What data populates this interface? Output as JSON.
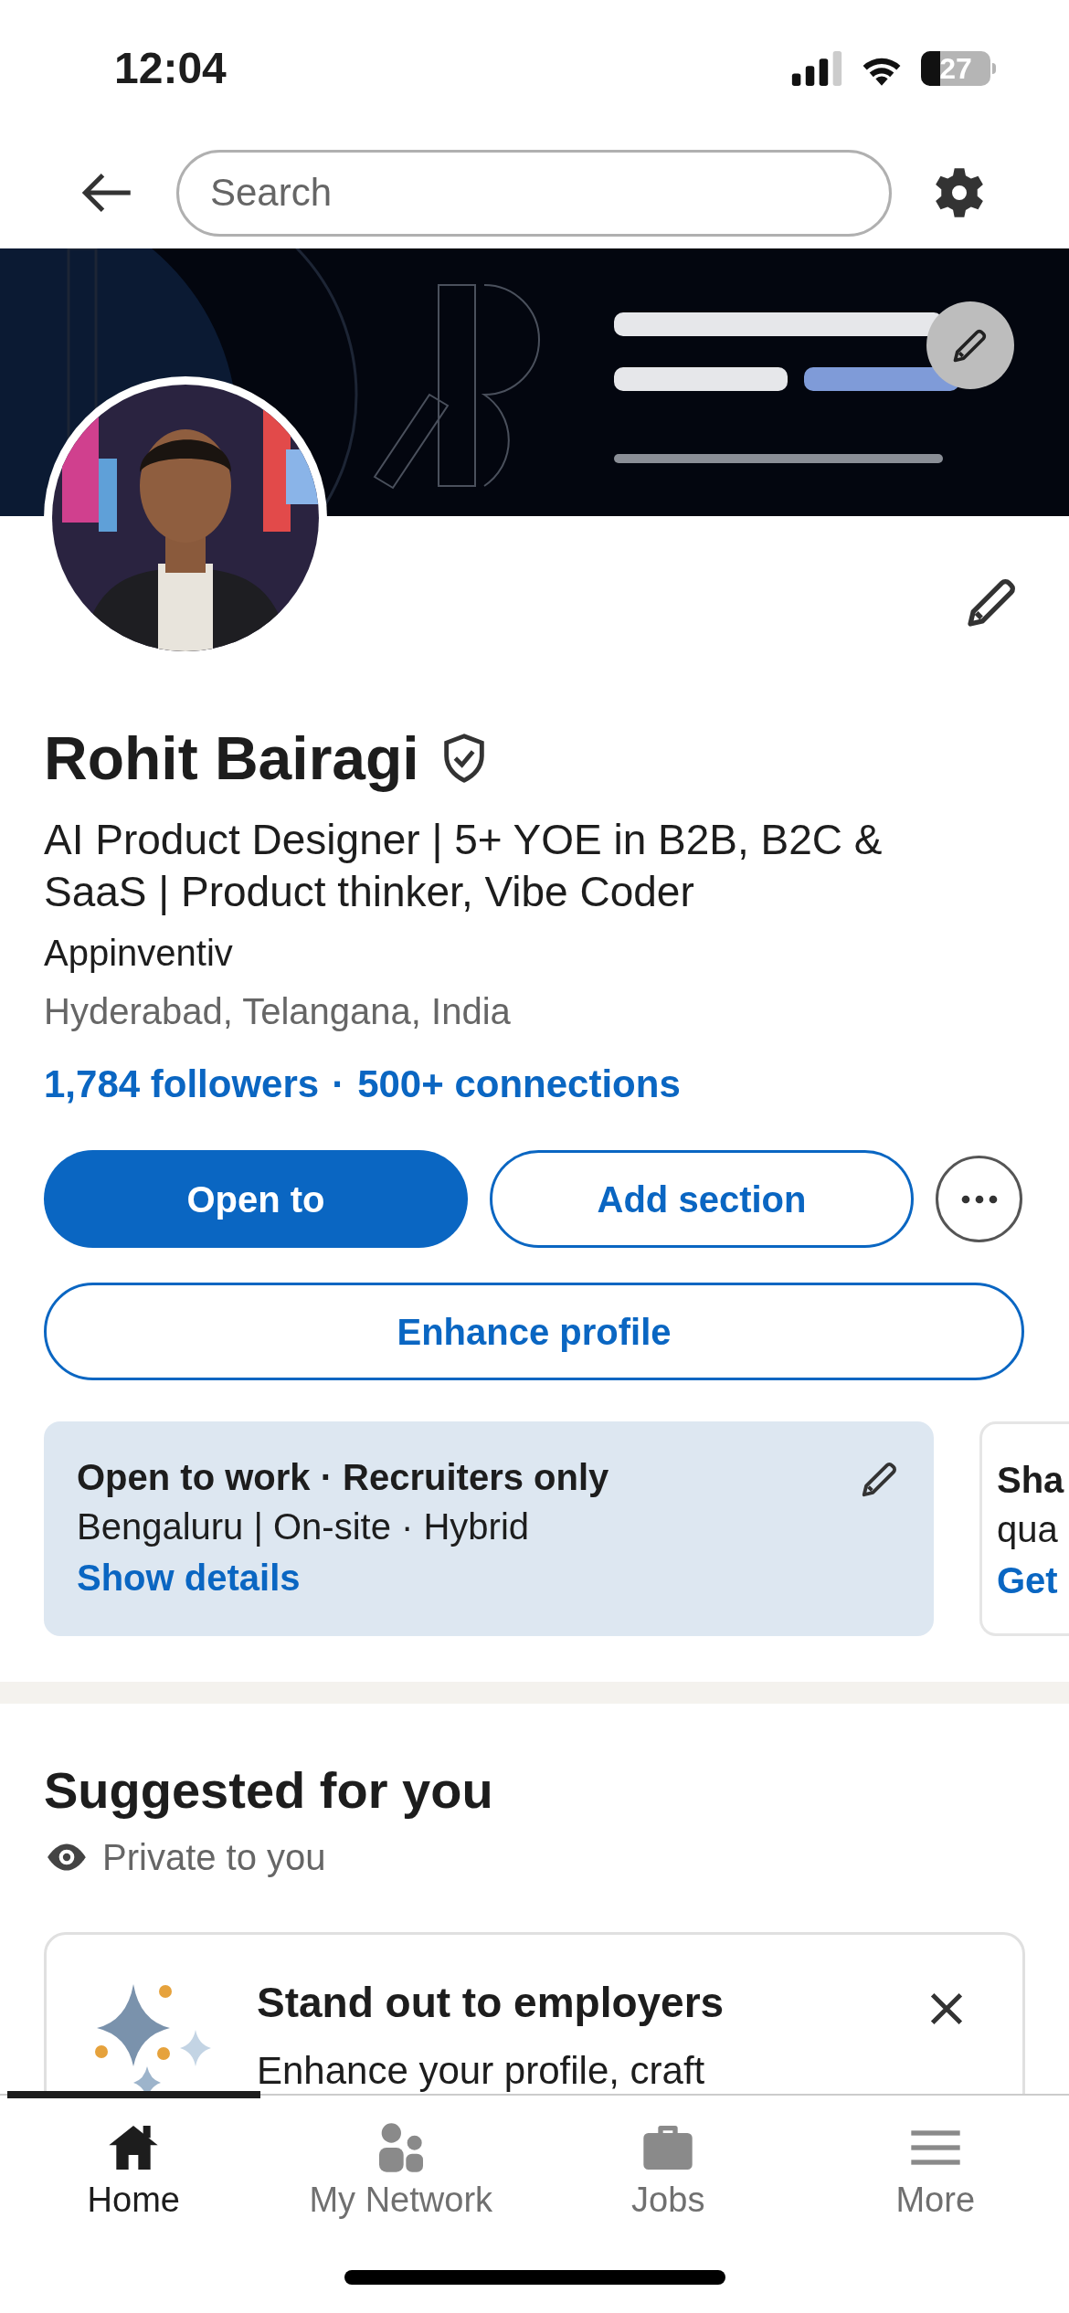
{
  "status_bar": {
    "time": "12:04",
    "battery": "27"
  },
  "top_bar": {
    "search": {
      "placeholder": "Search"
    }
  },
  "profile": {
    "name": "Rohit Bairagi",
    "headline": "AI Product Designer | 5+ YOE in B2B, B2C & SaaS | Product thinker, Vibe Coder",
    "company": "Appinventiv",
    "location": "Hyderabad, Telangana, India",
    "stats": [
      "1,784 followers",
      "·",
      "500+ connections"
    ]
  },
  "actions": [
    {
      "kind": "primary",
      "label": "Open to"
    },
    {
      "kind": "outline",
      "label": "Add section"
    },
    {
      "kind": "more"
    }
  ],
  "enhance_button": "Enhance profile",
  "cards": [
    {
      "title": "Open to work · Recruiters only",
      "subtitle": "Bengaluru | On-site · Hybrid",
      "link": "Show details",
      "editable": true
    },
    {
      "title": "Sha",
      "subtitle": "qua",
      "link": "Get"
    }
  ],
  "suggested": {
    "title": "Suggested for you",
    "privacy": "Private to you",
    "card": {
      "title": "Stand out to employers",
      "body": "Enhance your profile, craft"
    }
  },
  "nav": [
    {
      "label": "Home",
      "selected": true
    },
    {
      "label": "My Network",
      "selected": false
    },
    {
      "label": "Jobs",
      "selected": false
    },
    {
      "label": "More",
      "selected": false
    }
  ]
}
